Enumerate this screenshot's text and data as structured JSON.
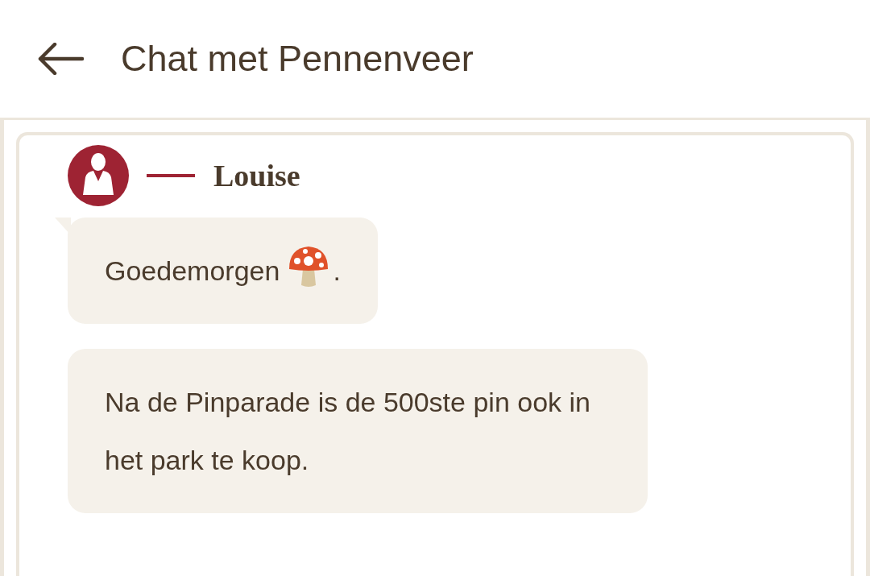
{
  "header": {
    "title": "Chat met Pennenveer"
  },
  "sender": {
    "name": "Louise"
  },
  "messages": [
    {
      "parts": [
        {
          "kind": "text",
          "text": "Goedemorgen"
        },
        {
          "kind": "mushroom"
        },
        {
          "kind": "text",
          "text": "."
        }
      ],
      "tail": true
    },
    {
      "parts": [
        {
          "kind": "text",
          "text": "Na de Pinparade is de 500ste pin ook in het park te koop."
        }
      ],
      "tail": false
    }
  ]
}
